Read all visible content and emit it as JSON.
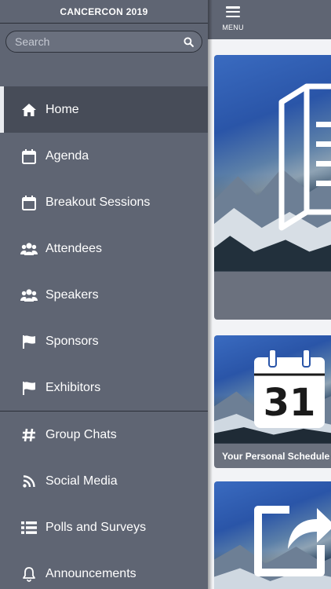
{
  "sidebar": {
    "title": "CANCERCON 2019",
    "search_placeholder": "Search",
    "items": [
      {
        "label": "Home",
        "icon": "home-icon"
      },
      {
        "label": "Agenda",
        "icon": "calendar-icon"
      },
      {
        "label": "Breakout Sessions",
        "icon": "calendar-icon"
      },
      {
        "label": "Attendees",
        "icon": "users-icon"
      },
      {
        "label": "Speakers",
        "icon": "users-icon"
      },
      {
        "label": "Sponsors",
        "icon": "flag-icon"
      },
      {
        "label": "Exhibitors",
        "icon": "flag-icon"
      },
      {
        "label": "Group Chats",
        "icon": "hashtag-icon"
      },
      {
        "label": "Social Media",
        "icon": "rss-icon"
      },
      {
        "label": "Polls and Surveys",
        "icon": "list-icon"
      },
      {
        "label": "Announcements",
        "icon": "bell-icon"
      }
    ],
    "active_item": "Home"
  },
  "header": {
    "menu_label": "MENU"
  },
  "tiles": [
    {
      "caption": "",
      "icon": "document-icon"
    },
    {
      "caption": "Your Personal Schedule",
      "icon": "calendar-31-icon",
      "day": "31"
    },
    {
      "caption": "",
      "icon": "share-icon"
    }
  ],
  "colors": {
    "sidebar_bg": "#5f6573",
    "active_bg": "#474c58",
    "content_bg": "#f2f3f6",
    "text": "#ffffff"
  }
}
